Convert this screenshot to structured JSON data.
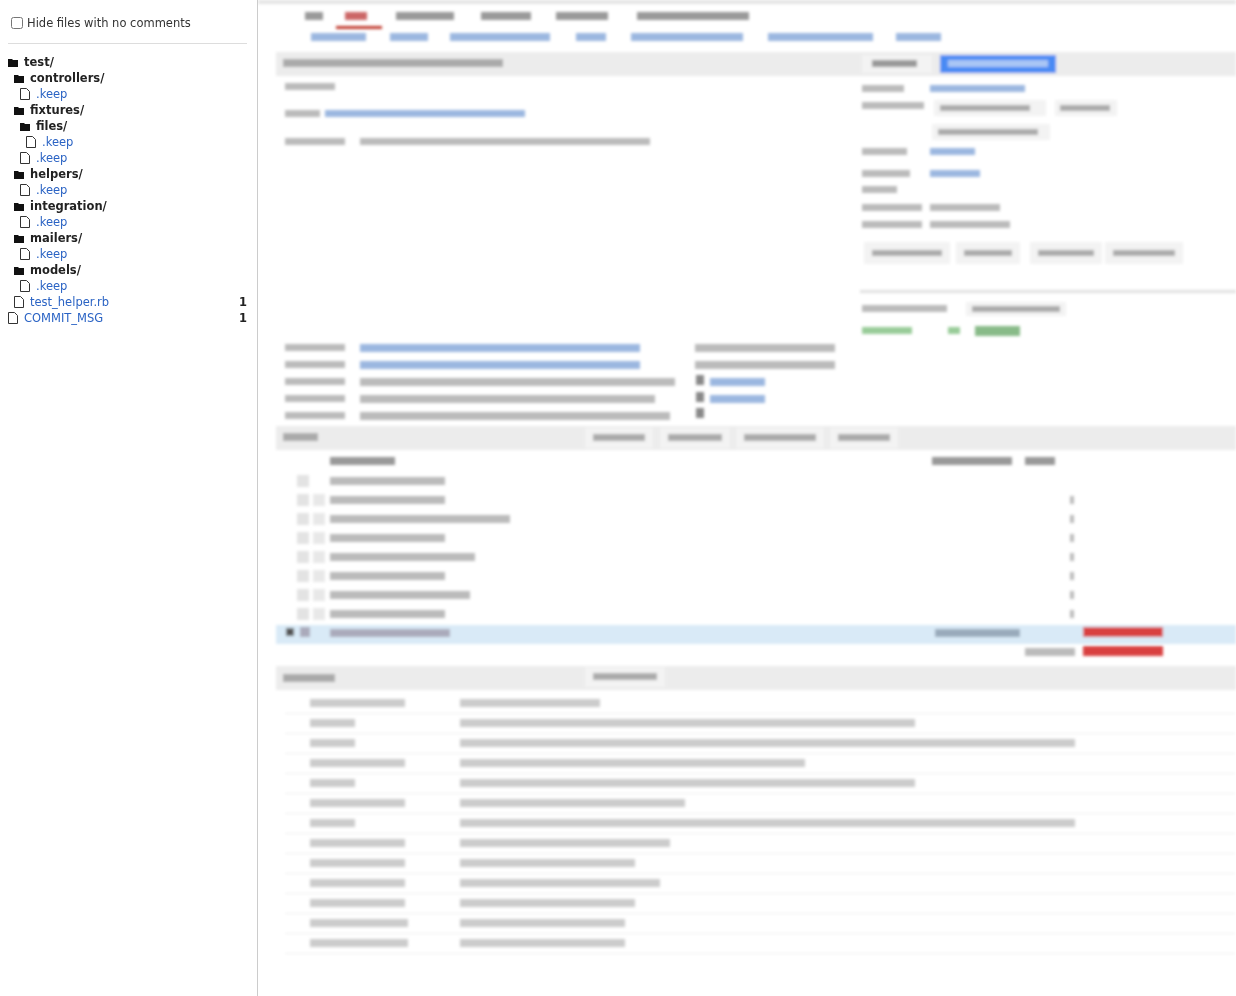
{
  "sidebar": {
    "hide_no_comments": {
      "label": "Hide files with no comments",
      "checked": false
    },
    "tree": [
      {
        "kind": "folder",
        "name": "test/",
        "children": [
          {
            "kind": "folder",
            "name": "controllers/",
            "children": [
              {
                "kind": "file",
                "name": ".keep"
              }
            ]
          },
          {
            "kind": "folder",
            "name": "fixtures/",
            "children": [
              {
                "kind": "folder",
                "name": "files/",
                "children": [
                  {
                    "kind": "file",
                    "name": ".keep"
                  }
                ]
              },
              {
                "kind": "file",
                "name": ".keep"
              }
            ]
          },
          {
            "kind": "folder",
            "name": "helpers/",
            "children": [
              {
                "kind": "file",
                "name": ".keep"
              }
            ]
          },
          {
            "kind": "folder",
            "name": "integration/",
            "children": [
              {
                "kind": "file",
                "name": ".keep"
              }
            ]
          },
          {
            "kind": "folder",
            "name": "mailers/",
            "children": [
              {
                "kind": "file",
                "name": ".keep"
              }
            ]
          },
          {
            "kind": "folder",
            "name": "models/",
            "children": [
              {
                "kind": "file",
                "name": ".keep"
              }
            ]
          },
          {
            "kind": "file",
            "name": "test_helper.rb",
            "count": "1"
          }
        ]
      },
      {
        "kind": "file",
        "name": "COMMIT_MSG",
        "count": "1"
      }
    ]
  }
}
